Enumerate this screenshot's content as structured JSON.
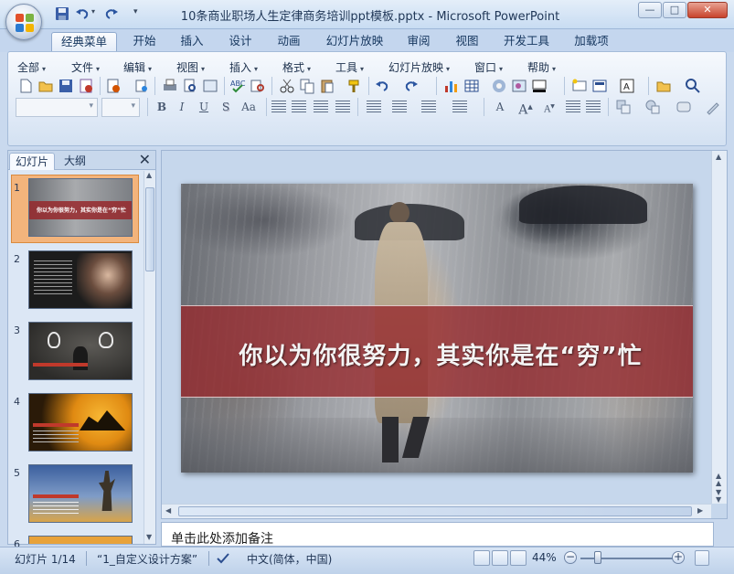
{
  "window": {
    "title": "10条商业职场人生定律商务培训ppt模板.pptx - Microsoft PowerPoint",
    "minimize": "—",
    "maximize": "□",
    "close": "✕"
  },
  "ribbon_tabs": [
    {
      "label": "经典菜单"
    },
    {
      "label": "开始"
    },
    {
      "label": "插入"
    },
    {
      "label": "设计"
    },
    {
      "label": "动画"
    },
    {
      "label": "幻灯片放映"
    },
    {
      "label": "审阅"
    },
    {
      "label": "视图"
    },
    {
      "label": "开发工具"
    },
    {
      "label": "加载项"
    }
  ],
  "classic_menu": [
    {
      "label": "全部"
    },
    {
      "label": "文件"
    },
    {
      "label": "编辑"
    },
    {
      "label": "视图"
    },
    {
      "label": "插入"
    },
    {
      "label": "格式"
    },
    {
      "label": "工具"
    },
    {
      "label": "幻灯片放映"
    },
    {
      "label": "窗口"
    },
    {
      "label": "帮助"
    }
  ],
  "format_toolbar": {
    "font_name": "",
    "font_size": "",
    "bold": "B",
    "italic": "I",
    "underline": "U",
    "shadow": "S",
    "case": "Aa",
    "text_color_letter": "A"
  },
  "slide_pane": {
    "tabs": [
      {
        "label": "幻灯片"
      },
      {
        "label": "大纲"
      }
    ],
    "close": "✕",
    "thumbnails": [
      {
        "number": "1",
        "selected": true,
        "caption": "你以为你很努力，其实你是在“穷”忙"
      },
      {
        "number": "2",
        "selected": false
      },
      {
        "number": "3",
        "selected": false
      },
      {
        "number": "4",
        "selected": false
      },
      {
        "number": "5",
        "selected": false
      },
      {
        "number": "6",
        "selected": false
      }
    ]
  },
  "slide": {
    "heading": "你以为你很努力，其实你是在“穷”忙"
  },
  "notes": {
    "placeholder": "单击此处添加备注"
  },
  "status_bar": {
    "slide_position": "幻灯片 1/14",
    "theme": "“1_自定义设计方案”",
    "language": "中文(简体，中国)",
    "zoom": "44%",
    "zoom_level": 44
  },
  "colors": {
    "accent_blue": "#3a74c4",
    "slide_band": "#962c2c",
    "selection_orange": "#f3b47c"
  }
}
